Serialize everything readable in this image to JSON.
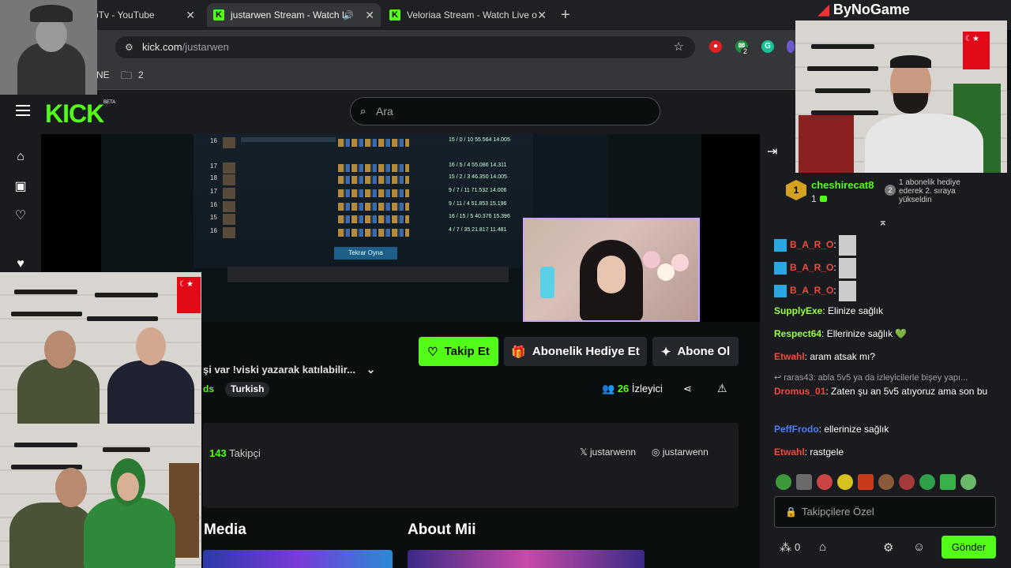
{
  "browser": {
    "tabs": [
      {
        "title": "pTv - YouTube",
        "active": false
      },
      {
        "title": "justarwen Stream - Watch L",
        "active": true
      },
      {
        "title": "Veloriaa Stream - Watch Live o",
        "active": false
      }
    ],
    "url_domain": "kick.com",
    "url_path": "/justarwen",
    "bookmarks": {
      "left_text": "NE",
      "folder_count": "2"
    },
    "extension_badge": "2"
  },
  "overlay": {
    "brand": "ByNoGame"
  },
  "kick": {
    "logo": "KICK",
    "beta": "BETA",
    "search_placeholder": "Ara"
  },
  "game": {
    "rows": [
      {
        "num": "16",
        "stat": "15 / 0 / 10   55.564   14.005"
      },
      {
        "num": "17",
        "stat": "16 / 5 / 4    55.086   14.311"
      },
      {
        "num": "18",
        "stat": "15 / 2 / 3    46.350   14.005"
      },
      {
        "num": "17",
        "stat": "9 / 7 / 11    71.532   14.006"
      },
      {
        "num": "16",
        "stat": "9 / 11 / 4    51.853   15.196"
      },
      {
        "num": "15",
        "stat": "16 / 15 / 5   40.376   15.396"
      },
      {
        "num": "16",
        "stat": "4 / 7 / 35    21.817   11.481"
      }
    ],
    "replay_label": "Tekrar Oyna"
  },
  "stream": {
    "follow_label": "Takip Et",
    "gift_label": "Abonelik Hediye Et",
    "subscribe_label": "Abone Ol",
    "title": "şi var !viski yazarak katılabilir...",
    "category": "ds",
    "tag": "Turkish",
    "viewer_count": "26",
    "viewer_label": "İzleyici"
  },
  "about": {
    "follower_count": "143",
    "follower_label": "Takipçi",
    "x_handle": "justarwenn",
    "instagram_handle": "justarwenn",
    "sections": [
      "Media",
      "About Mii"
    ]
  },
  "chat": {
    "pinned": {
      "user": "cheshirecat8",
      "rank": "1",
      "count": "1",
      "note": "1 abonelik hediye ederek 2. sıraya yükseldin",
      "note_rank": "2"
    },
    "messages": [
      {
        "user": "B_A_R_O",
        "color": "red",
        "text": ":"
      },
      {
        "user": "B_A_R_O",
        "color": "red",
        "text": ":"
      },
      {
        "user": "B_A_R_O",
        "color": "red",
        "text": ":"
      },
      {
        "user": "SupplyExe",
        "color": "lime",
        "text": ": Elinize sağlık"
      },
      {
        "user": "Respect64",
        "color": "lime",
        "text": ": Ellerinize sağlık 💚"
      },
      {
        "user": "Etwahl",
        "color": "red",
        "text": ": aram atsak mı?"
      },
      {
        "user": "",
        "color": "reply",
        "text": "↩ raras43: abla 5v5 ya da izleyicilerle bişey yapı..."
      },
      {
        "user": "Dromus_01",
        "color": "red",
        "text": ": Zaten şu an 5v5 atıyoruz ama son bu"
      },
      {
        "user": "PeffFrodo",
        "color": "blue",
        "text": ": ellerinize sağlık"
      },
      {
        "user": "Etwahl",
        "color": "red",
        "text": ": rastgele"
      }
    ],
    "input_placeholder": "Takipçilere Özel",
    "points": "0",
    "send_label": "Gönder"
  }
}
